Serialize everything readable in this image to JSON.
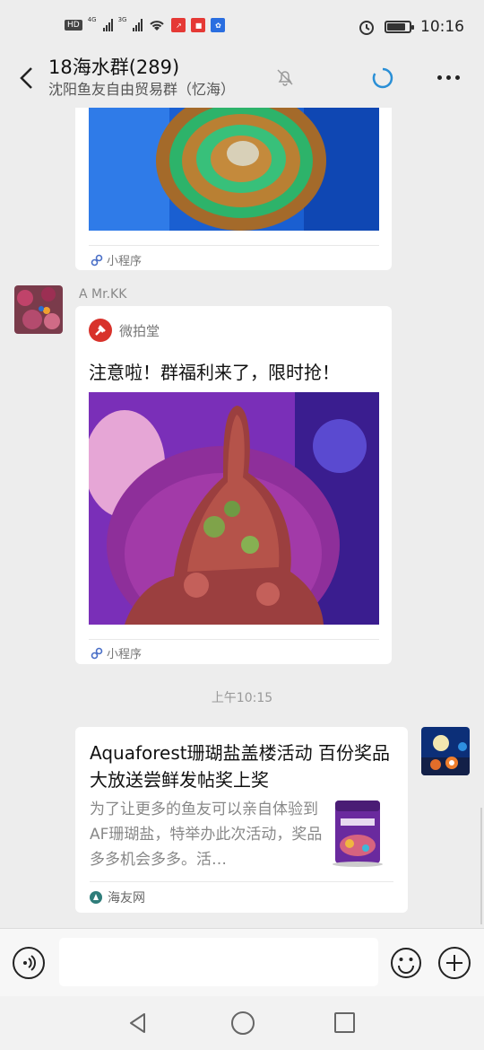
{
  "status_bar": {
    "left_badges": [
      "HD",
      "4G",
      "3G"
    ],
    "time": "10:16",
    "battery_level": 0.85
  },
  "header": {
    "title": "18海水群(289)",
    "subtitle": "沈阳鱼友自由贸易群（忆海）"
  },
  "messages": [
    {
      "type": "mini_program_partial",
      "footer_label": "小程序"
    },
    {
      "type": "mini_program",
      "sender": "A  Mr.KK",
      "app_name": "微拍堂",
      "title": "注意啦！群福利来了，限时抢！",
      "footer_label": "小程序"
    },
    {
      "type": "timestamp",
      "text": "上午10:15"
    },
    {
      "type": "link_card",
      "title": "Aquaforest珊瑚盐盖楼活动 百份奖品大放送尝鲜发帖奖上奖",
      "description": "为了让更多的鱼友可以亲自体验到AF珊瑚盐，特举办此次活动，奖品多多机会多多。活…",
      "source": "海友网"
    }
  ],
  "input_bar": {
    "placeholder": ""
  },
  "colors": {
    "background": "#ededed",
    "card": "#ffffff",
    "accent_blue": "#2a8fd6",
    "app_red": "#d8322b"
  }
}
